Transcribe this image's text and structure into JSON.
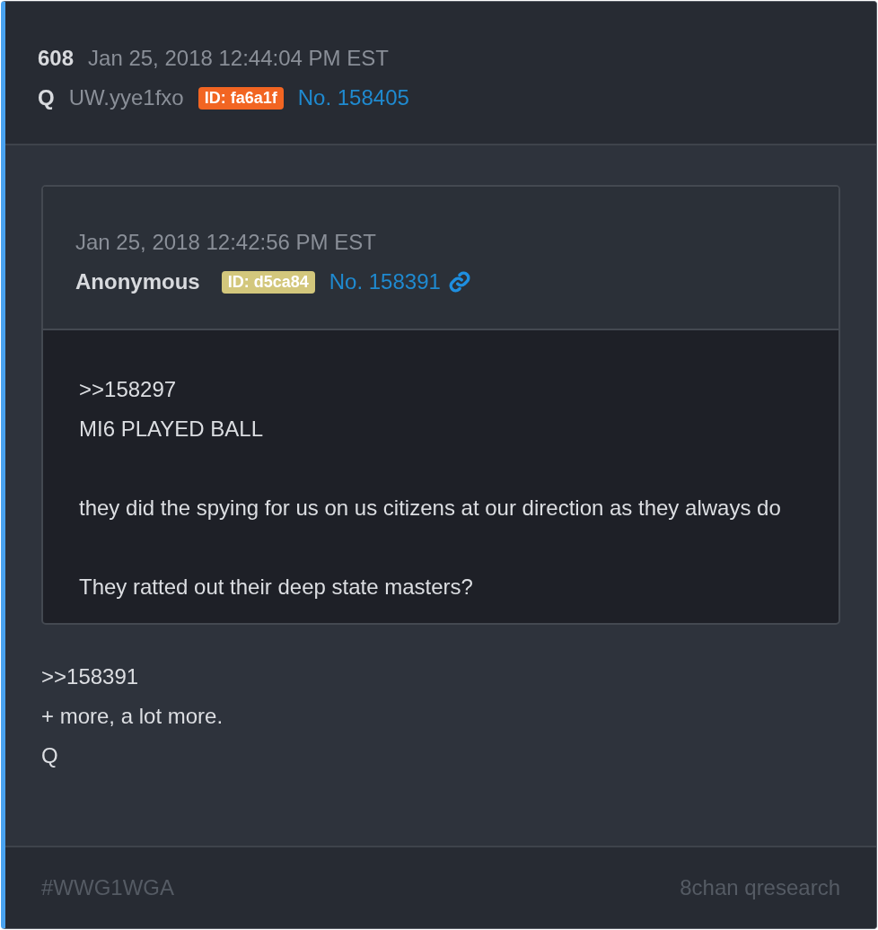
{
  "post": {
    "number": "608",
    "date": "Jan 25, 2018 12:44:04 PM EST",
    "author": "Q",
    "tripcode": "UW.yye1fxo",
    "id_badge": {
      "label": "ID: fa6a1f",
      "color": "#f26522"
    },
    "post_no": "No. 158405"
  },
  "quote": {
    "date": "Jan 25, 2018 12:42:56 PM EST",
    "author": "Anonymous",
    "id_badge": {
      "label": "ID: d5ca84",
      "color": "#d3c77c"
    },
    "post_no": "No. 158391",
    "paragraphs": [
      [
        ">>158297",
        "MI6 PLAYED BALL"
      ],
      [
        "they did the spying for us on us citizens at our direction as they always do"
      ],
      [
        "They ratted out their deep state masters?"
      ]
    ]
  },
  "body": [
    ">>158391",
    "+ more, a lot more.",
    "Q"
  ],
  "footer": {
    "tag": "#WWG1WGA",
    "source": "8chan qresearch"
  }
}
